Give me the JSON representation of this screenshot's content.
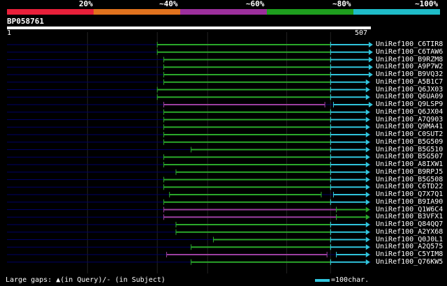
{
  "legend": {
    "labels": [
      "20%",
      "~40%",
      "~60%",
      "~80%",
      "~100%"
    ],
    "colors": [
      "#e8203a",
      "#e0721e",
      "#9c2f9c",
      "#1e9e1e",
      "#1fbcc8"
    ]
  },
  "query": {
    "id": "BP058761",
    "start": "1",
    "end": "507",
    "length": 507
  },
  "colors": {
    "background": "#000000",
    "query_bar": "#ffffff",
    "hit_baseline": "#000066",
    "green": "#2aa82a",
    "purple": "#9c3fa0",
    "cyan": "#30c4dc",
    "grid": "#222222"
  },
  "hits": [
    {
      "name": "UniRef100_C6TIR8",
      "segs": [
        {
          "s": 210,
          "e": 451,
          "c": "green"
        },
        {
          "s": 451,
          "e": 504,
          "c": "cyan"
        }
      ]
    },
    {
      "name": "UniRef100_C6TAW6",
      "segs": [
        {
          "s": 210,
          "e": 451,
          "c": "green"
        },
        {
          "s": 451,
          "e": 504,
          "c": "cyan"
        }
      ]
    },
    {
      "name": "UniRef100_B9RZM8",
      "segs": [
        {
          "s": 219,
          "e": 451,
          "c": "green"
        },
        {
          "s": 451,
          "e": 504,
          "c": "cyan"
        }
      ]
    },
    {
      "name": "UniRef100_A9P7W2",
      "segs": [
        {
          "s": 219,
          "e": 451,
          "c": "green"
        },
        {
          "s": 451,
          "e": 504,
          "c": "cyan"
        }
      ]
    },
    {
      "name": "UniRef100_B9VQ32",
      "segs": [
        {
          "s": 219,
          "e": 451,
          "c": "green"
        },
        {
          "s": 451,
          "e": 504,
          "c": "cyan"
        }
      ]
    },
    {
      "name": "UniRef100_A5B1C7",
      "segs": [
        {
          "s": 219,
          "e": 451,
          "c": "green"
        },
        {
          "s": 451,
          "e": 500,
          "c": "cyan"
        }
      ]
    },
    {
      "name": "UniRef100_Q6JX03",
      "segs": [
        {
          "s": 210,
          "e": 451,
          "c": "green"
        },
        {
          "s": 451,
          "e": 500,
          "c": "cyan"
        }
      ]
    },
    {
      "name": "UniRef100_Q6UA09",
      "segs": [
        {
          "s": 210,
          "e": 451,
          "c": "green"
        },
        {
          "s": 451,
          "e": 500,
          "c": "cyan"
        }
      ]
    },
    {
      "name": "UniRef100_Q9LSP9",
      "segs": [
        {
          "s": 219,
          "e": 443,
          "c": "purple"
        },
        {
          "s": 455,
          "e": 504,
          "c": "cyan"
        }
      ]
    },
    {
      "name": "UniRef100_Q6JX04",
      "segs": [
        {
          "s": 219,
          "e": 451,
          "c": "green"
        },
        {
          "s": 451,
          "e": 500,
          "c": "cyan"
        }
      ]
    },
    {
      "name": "UniRef100_A7Q903",
      "segs": [
        {
          "s": 219,
          "e": 451,
          "c": "green"
        },
        {
          "s": 451,
          "e": 500,
          "c": "cyan"
        }
      ]
    },
    {
      "name": "UniRef100_Q9MA41",
      "segs": [
        {
          "s": 219,
          "e": 451,
          "c": "green"
        },
        {
          "s": 451,
          "e": 500,
          "c": "cyan"
        }
      ]
    },
    {
      "name": "UniRef100_C0SUT2",
      "segs": [
        {
          "s": 219,
          "e": 451,
          "c": "green"
        },
        {
          "s": 451,
          "e": 500,
          "c": "cyan"
        }
      ]
    },
    {
      "name": "UniRef100_B5G509",
      "segs": [
        {
          "s": 219,
          "e": 451,
          "c": "green"
        },
        {
          "s": 451,
          "e": 500,
          "c": "cyan"
        }
      ]
    },
    {
      "name": "UniRef100_B5G510",
      "segs": [
        {
          "s": 257,
          "e": 451,
          "c": "green"
        },
        {
          "s": 451,
          "e": 500,
          "c": "cyan"
        }
      ]
    },
    {
      "name": "UniRef100_B5G507",
      "segs": [
        {
          "s": 219,
          "e": 451,
          "c": "green"
        },
        {
          "s": 451,
          "e": 500,
          "c": "cyan"
        }
      ]
    },
    {
      "name": "UniRef100_A8IXW1",
      "segs": [
        {
          "s": 219,
          "e": 451,
          "c": "green"
        },
        {
          "s": 451,
          "e": 500,
          "c": "cyan"
        }
      ]
    },
    {
      "name": "UniRef100_B9RPJ5",
      "segs": [
        {
          "s": 236,
          "e": 451,
          "c": "green"
        },
        {
          "s": 451,
          "e": 500,
          "c": "cyan"
        }
      ]
    },
    {
      "name": "UniRef100_B5G508",
      "segs": [
        {
          "s": 219,
          "e": 451,
          "c": "green"
        },
        {
          "s": 451,
          "e": 500,
          "c": "cyan"
        }
      ]
    },
    {
      "name": "UniRef100_C6TD22",
      "segs": [
        {
          "s": 219,
          "e": 451,
          "c": "green"
        },
        {
          "s": 451,
          "e": 500,
          "c": "cyan"
        }
      ]
    },
    {
      "name": "UniRef100_Q7X7Q1",
      "segs": [
        {
          "s": 227,
          "e": 438,
          "c": "green"
        },
        {
          "s": 455,
          "e": 500,
          "c": "cyan"
        }
      ]
    },
    {
      "name": "UniRef100_B9IA90",
      "segs": [
        {
          "s": 219,
          "e": 451,
          "c": "green"
        },
        {
          "s": 451,
          "e": 500,
          "c": "cyan"
        }
      ]
    },
    {
      "name": "UniRef100_Q1W6C4",
      "segs": [
        {
          "s": 219,
          "e": 459,
          "c": "purple"
        },
        {
          "s": 459,
          "e": 500,
          "c": "green"
        }
      ]
    },
    {
      "name": "UniRef100_B3VFX1",
      "segs": [
        {
          "s": 219,
          "e": 459,
          "c": "purple"
        },
        {
          "s": 459,
          "e": 500,
          "c": "green"
        }
      ]
    },
    {
      "name": "UniRef100_Q84QQ7",
      "segs": [
        {
          "s": 236,
          "e": 451,
          "c": "green"
        },
        {
          "s": 451,
          "e": 500,
          "c": "cyan"
        }
      ]
    },
    {
      "name": "UniRef100_A2YX68",
      "segs": [
        {
          "s": 236,
          "e": 451,
          "c": "green"
        },
        {
          "s": 451,
          "e": 500,
          "c": "cyan"
        }
      ]
    },
    {
      "name": "UniRef100_Q0J0L1",
      "segs": [
        {
          "s": 288,
          "e": 451,
          "c": "green"
        },
        {
          "s": 451,
          "e": 500,
          "c": "cyan"
        }
      ]
    },
    {
      "name": "UniRef100_A2Q575",
      "segs": [
        {
          "s": 257,
          "e": 451,
          "c": "green"
        },
        {
          "s": 451,
          "e": 500,
          "c": "cyan"
        }
      ]
    },
    {
      "name": "UniRef100_C5YIM8",
      "segs": [
        {
          "s": 223,
          "e": 446,
          "c": "purple"
        },
        {
          "s": 459,
          "e": 500,
          "c": "cyan"
        }
      ]
    },
    {
      "name": "UniRef100_Q76KW5",
      "segs": [
        {
          "s": 257,
          "e": 451,
          "c": "green"
        },
        {
          "s": 451,
          "e": 500,
          "c": "cyan"
        }
      ]
    }
  ],
  "footer": {
    "note": "Large gaps: ▲(in Query)/- (in Subject)",
    "scale_label": "=100char."
  }
}
